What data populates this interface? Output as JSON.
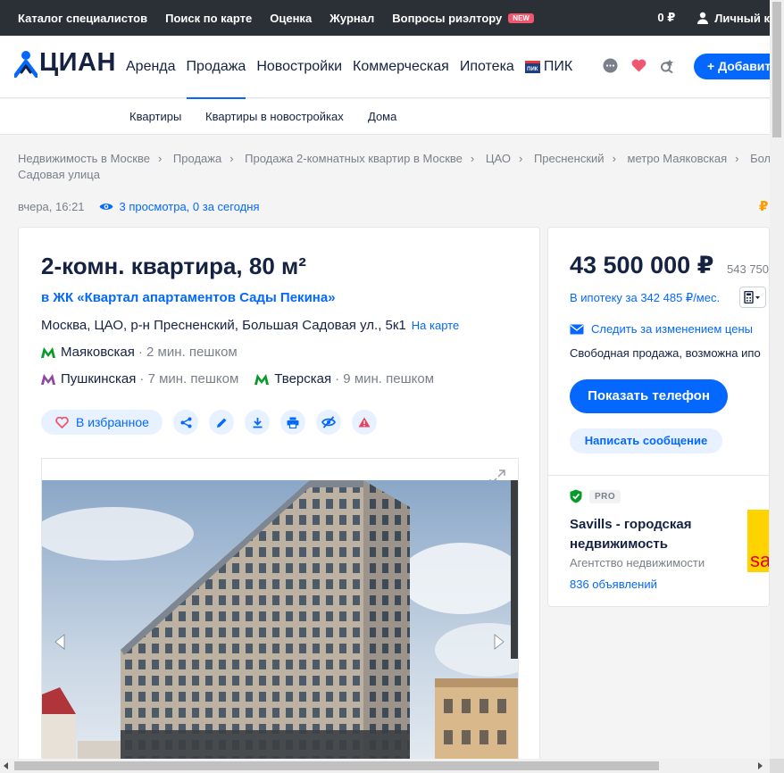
{
  "topbar": {
    "links": [
      "Каталог специалистов",
      "Поиск по карте",
      "Оценка",
      "Журнал",
      "Вопросы риэлтору"
    ],
    "new_badge": "NEW",
    "balance": "0 ₽",
    "account": "Личный к"
  },
  "header": {
    "logo_text": "ЦИАН",
    "nav": [
      "Аренда",
      "Продажа",
      "Новостройки",
      "Коммерческая",
      "Ипотека",
      "ПИК"
    ],
    "pik_logo_text": "ПИК",
    "add_button": "+ Добавить"
  },
  "subnav": [
    "Квартиры",
    "Квартиры в новостройках",
    "Дома"
  ],
  "breadcrumbs": [
    "Недвижимость в Москве",
    "Продажа",
    "Продажа 2-комнатных квартир в Москве",
    "ЦАО",
    "Пресненский",
    "метро Маяковская",
    "Бол"
  ],
  "breadcrumbs_line2": "Садовая улица",
  "meta": {
    "published": "вчера, 16:21",
    "views": "3 просмотра, 0 за сегодня",
    "currency_edge": "₽"
  },
  "listing": {
    "title": "2-комн. квартира, 80 м²",
    "complex": "в ЖК «Квартал апартаментов Сады Пекина»",
    "address": "Москва, ЦАО, р-н Пресненский, Большая Садовая ул., 5к1",
    "map_link": "На карте",
    "metro": [
      {
        "name": "Маяковская",
        "walk": "· 2 мин. пешком",
        "color": "#049b26"
      },
      {
        "name": "Пушкинская",
        "walk": "· 7 мин. пешком",
        "color": "#8e479c"
      },
      {
        "name": "Тверская",
        "walk": "· 9 мин. пешком",
        "color": "#049b26"
      }
    ],
    "favorite_label": "В избранное"
  },
  "price_panel": {
    "price": "43 500 000 ₽",
    "price_per_m2": "543 750",
    "mortgage": "В ипотеку за 342 485 ₽/мес.",
    "track_price": "Следить за изменением цены",
    "sale_type": "Свободная продажа, возможна ипо",
    "phone_button": "Показать телефон",
    "message_button": "Написать сообщение",
    "pro_badge": "PRO",
    "agency_name": "Savills - городская недвижимость",
    "agency_type": "Агентство недвижимости",
    "agency_listings": "836 объявлений",
    "agency_logo_text": "sa"
  },
  "colors": {
    "accent": "#0468ff",
    "topbar": "#2b3036",
    "text": "#152242",
    "muted": "#7a7f89"
  }
}
